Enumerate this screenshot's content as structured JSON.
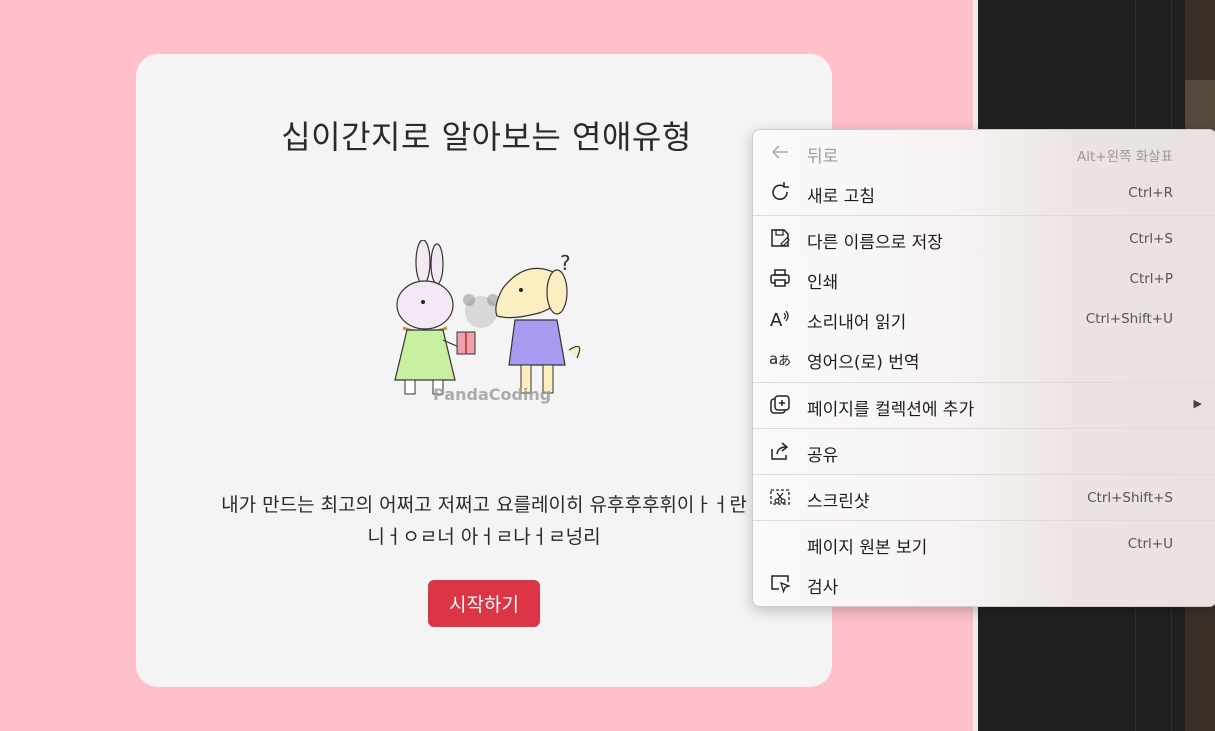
{
  "page": {
    "title": "십이간지로 알아보는 연애유형",
    "illustration_watermark": "PandaCoding",
    "description_line1": "내가 만드는 최고의 어쩌고 저쩌고 요를레이히 유후후후휘이ㅏㅓ란",
    "description_line2": "니ㅓㅇㄹ너 아ㅓㄹ나ㅓㄹ넝리",
    "start_button": "시작하기"
  },
  "context_menu": {
    "items": [
      {
        "label": "뒤로",
        "shortcut": "Alt+왼쪽 화살표",
        "icon": "back-arrow-icon",
        "disabled": true
      },
      {
        "label": "새로 고침",
        "shortcut": "Ctrl+R",
        "icon": "refresh-icon"
      },
      {
        "label": "다른 이름으로 저장",
        "shortcut": "Ctrl+S",
        "icon": "save-as-icon"
      },
      {
        "label": "인쇄",
        "shortcut": "Ctrl+P",
        "icon": "print-icon"
      },
      {
        "label": "소리내어 읽기",
        "shortcut": "Ctrl+Shift+U",
        "icon": "read-aloud-icon"
      },
      {
        "label": "영어으(로) 번역",
        "shortcut": "",
        "icon": "translate-icon"
      },
      {
        "label": "페이지를 컬렉션에 추가",
        "shortcut": "",
        "icon": "collections-add-icon",
        "submenu": true
      },
      {
        "label": "공유",
        "shortcut": "",
        "icon": "share-icon"
      },
      {
        "label": "스크린샷",
        "shortcut": "Ctrl+Shift+S",
        "icon": "screenshot-icon"
      },
      {
        "label": "페이지 원본 보기",
        "shortcut": "Ctrl+U",
        "icon": ""
      },
      {
        "label": "검사",
        "shortcut": "",
        "icon": "inspect-icon"
      }
    ]
  },
  "colors": {
    "background": "#ffc0cb",
    "card": "#f5f4f4",
    "button": "#dc3545",
    "devtools": "#202020"
  }
}
